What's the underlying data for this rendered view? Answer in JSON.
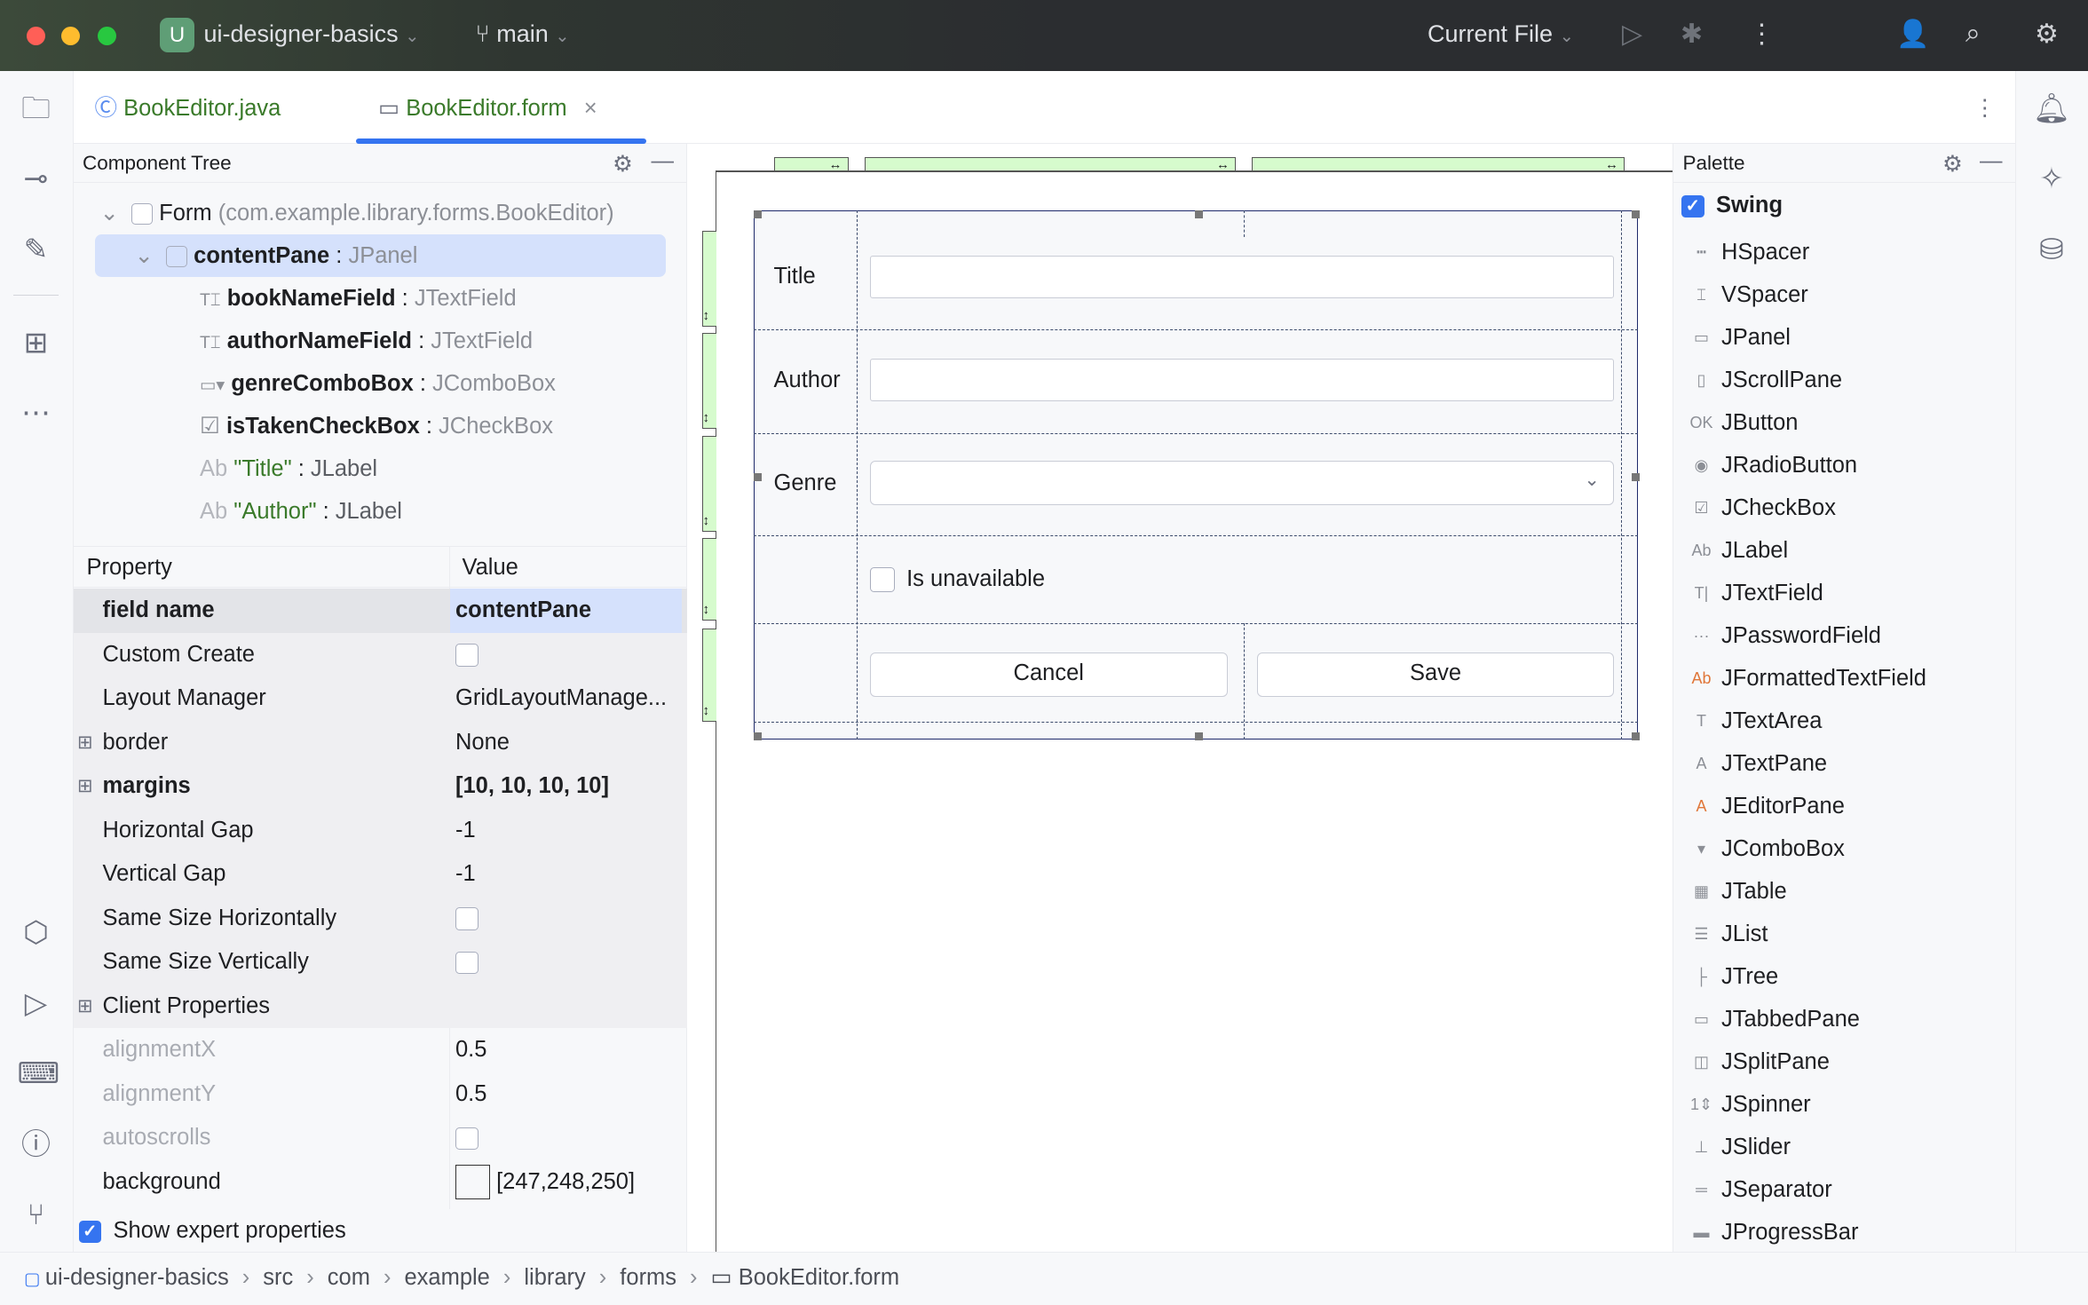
{
  "titlebar": {
    "project_initial": "U",
    "project": "ui-designer-basics",
    "branch": "main",
    "run_config": "Current File"
  },
  "tabs": [
    {
      "label": "BookEditor.java",
      "active": false
    },
    {
      "label": "BookEditor.form",
      "active": true
    }
  ],
  "component_tree": {
    "title": "Component Tree",
    "items": [
      {
        "name": "Form",
        "type": "(com.example.library.forms.BookEditor)"
      },
      {
        "name": "contentPane",
        "type": "JPanel",
        "selected": true
      },
      {
        "name": "bookNameField",
        "type": "JTextField"
      },
      {
        "name": "authorNameField",
        "type": "JTextField"
      },
      {
        "name": "genreComboBox",
        "type": "JComboBox"
      },
      {
        "name": "isTakenCheckBox",
        "type": "JCheckBox"
      },
      {
        "name": "\"Title\"",
        "type": "JLabel"
      },
      {
        "name": "\"Author\"",
        "type": "JLabel"
      }
    ],
    "separator": " : "
  },
  "properties": {
    "header_property": "Property",
    "header_value": "Value",
    "rows": [
      {
        "name": "field name",
        "value": "contentPane"
      },
      {
        "name": "Custom Create",
        "value": ""
      },
      {
        "name": "Layout Manager",
        "value": "GridLayoutManage..."
      },
      {
        "name": "border",
        "value": "None"
      },
      {
        "name": "margins",
        "value": "[10, 10, 10, 10]"
      },
      {
        "name": "Horizontal Gap",
        "value": "-1"
      },
      {
        "name": "Vertical Gap",
        "value": "-1"
      },
      {
        "name": "Same Size Horizontally",
        "value": ""
      },
      {
        "name": "Same Size Vertically",
        "value": ""
      },
      {
        "name": "Client Properties",
        "value": ""
      },
      {
        "name": "alignmentX",
        "value": "0.5"
      },
      {
        "name": "alignmentY",
        "value": "0.5"
      },
      {
        "name": "autoscrolls",
        "value": ""
      },
      {
        "name": "background",
        "value": "[247,248,250]"
      }
    ],
    "show_expert": "Show expert properties"
  },
  "form": {
    "title_label": "Title",
    "author_label": "Author",
    "genre_label": "Genre",
    "checkbox_label": "Is unavailable",
    "cancel": "Cancel",
    "save": "Save"
  },
  "palette": {
    "title": "Palette",
    "group": "Swing",
    "items": [
      "HSpacer",
      "VSpacer",
      "JPanel",
      "JScrollPane",
      "JButton",
      "JRadioButton",
      "JCheckBox",
      "JLabel",
      "JTextField",
      "JPasswordField",
      "JFormattedTextField",
      "JTextArea",
      "JTextPane",
      "JEditorPane",
      "JComboBox",
      "JTable",
      "JList",
      "JTree",
      "JTabbedPane",
      "JSplitPane",
      "JSpinner",
      "JSlider",
      "JSeparator",
      "JProgressBar"
    ],
    "icons": [
      "┅",
      "⌶",
      "▭",
      "▯",
      "OK",
      "◉",
      "☑",
      "Ab",
      "T|",
      "···",
      "Ab",
      "T",
      "A",
      "A",
      "▾",
      "▦",
      "☰",
      "├",
      "▭",
      "◫",
      "1⇕",
      "⊥",
      "═",
      "▬"
    ]
  },
  "breadcrumbs": [
    "ui-designer-basics",
    "src",
    "com",
    "example",
    "library",
    "forms",
    "BookEditor.form"
  ]
}
